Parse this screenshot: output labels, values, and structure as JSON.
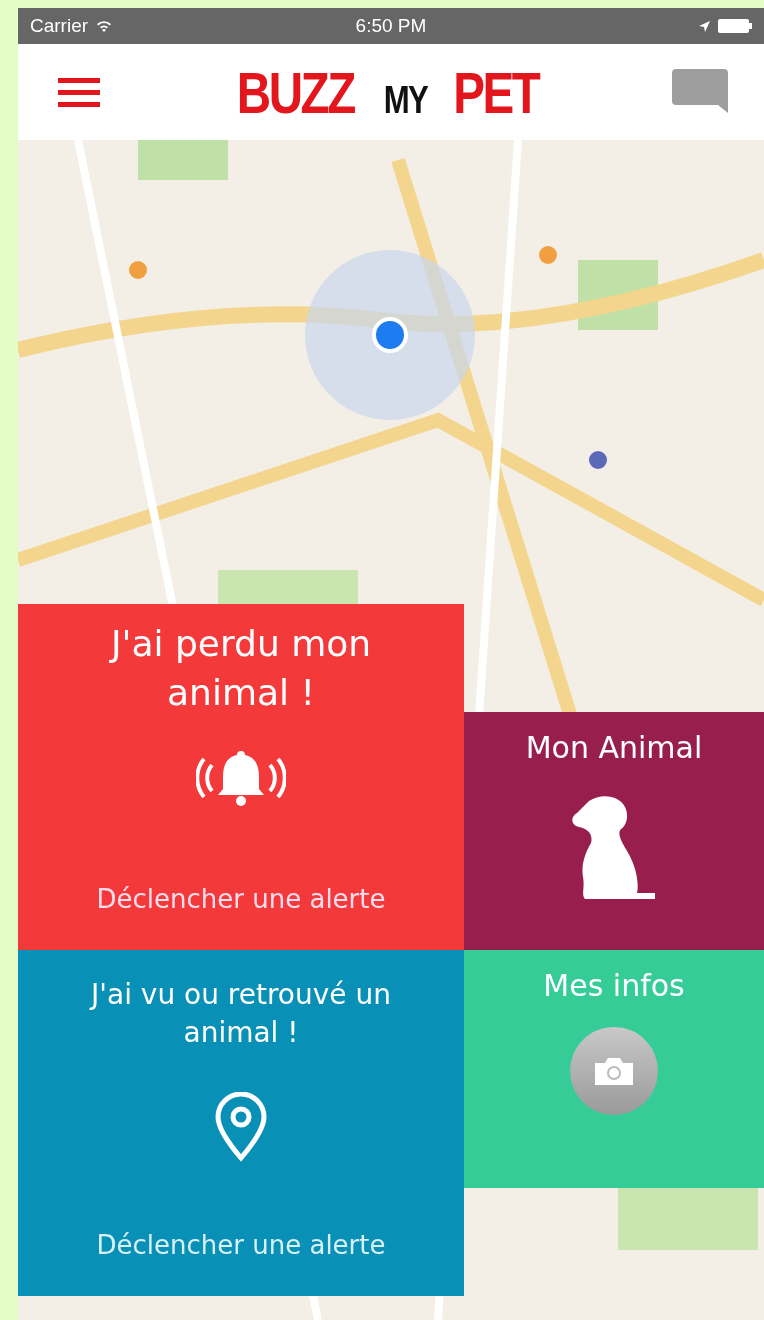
{
  "status_bar": {
    "carrier": "Carrier",
    "time": "6:50 PM"
  },
  "header": {
    "logo": [
      {
        "text": "BUZZ",
        "color": "#e3151d"
      },
      {
        "text": "MY",
        "color": "#111111"
      },
      {
        "text": "PET",
        "color": "#e3151d"
      }
    ]
  },
  "tiles": [
    {
      "kind": "lost",
      "title": "J'ai perdu mon animal !",
      "subtitle": "Déclencher une alerte",
      "color": "#f3393a"
    },
    {
      "kind": "pet",
      "title": "Mon Animal",
      "color": "#981e4d"
    },
    {
      "kind": "found",
      "title": "J'ai vu ou retrouvé un animal !",
      "subtitle": "Déclencher une alerte",
      "color": "#0990b6"
    },
    {
      "kind": "info",
      "title": "Mes infos",
      "color": "#36cc97"
    }
  ]
}
